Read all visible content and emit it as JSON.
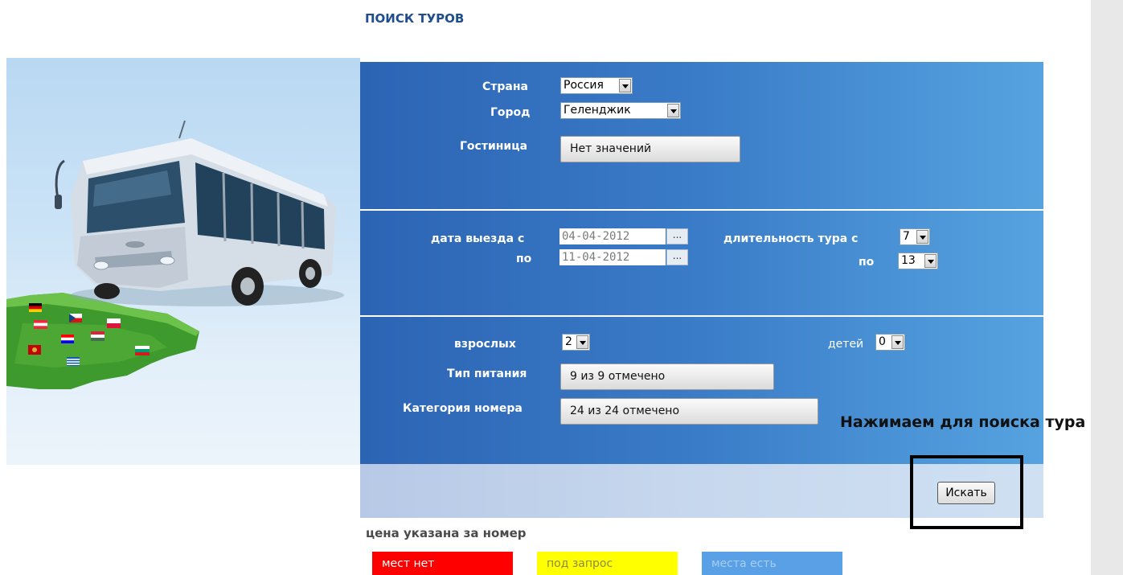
{
  "page_title": "ПОИСК ТУРОВ",
  "form": {
    "country": {
      "label": "Страна",
      "value": "Россия"
    },
    "city": {
      "label": "Город",
      "value": "Геленджик"
    },
    "hotel": {
      "label": "Гостиница",
      "value": "Нет значений"
    },
    "departure_from": {
      "label": "дата выезда с",
      "value": "04-04-2012",
      "button": "..."
    },
    "departure_to": {
      "label": "по",
      "value": "11-04-2012",
      "button": "..."
    },
    "duration_from": {
      "label": "длительность тура с",
      "value": "7"
    },
    "duration_to": {
      "label": "по",
      "value": "13"
    },
    "adults": {
      "label": "взрослых",
      "value": "2"
    },
    "children": {
      "label": "детей",
      "value": "0"
    },
    "meal_type": {
      "label": "Тип питания",
      "value": "9 из 9 отмечено"
    },
    "room_category": {
      "label": "Категория номера",
      "value": "24 из 24 отмечено"
    }
  },
  "annotation": "Нажимаем для поиска тура",
  "search_button": "Искать",
  "price_note": "цена указана за номер",
  "legend": [
    {
      "label": "мест нет",
      "color": "#ff0000"
    },
    {
      "label": "под запрос",
      "color": "#ffff00"
    },
    {
      "label": "места есть",
      "color": "#5aa0e6"
    }
  ]
}
